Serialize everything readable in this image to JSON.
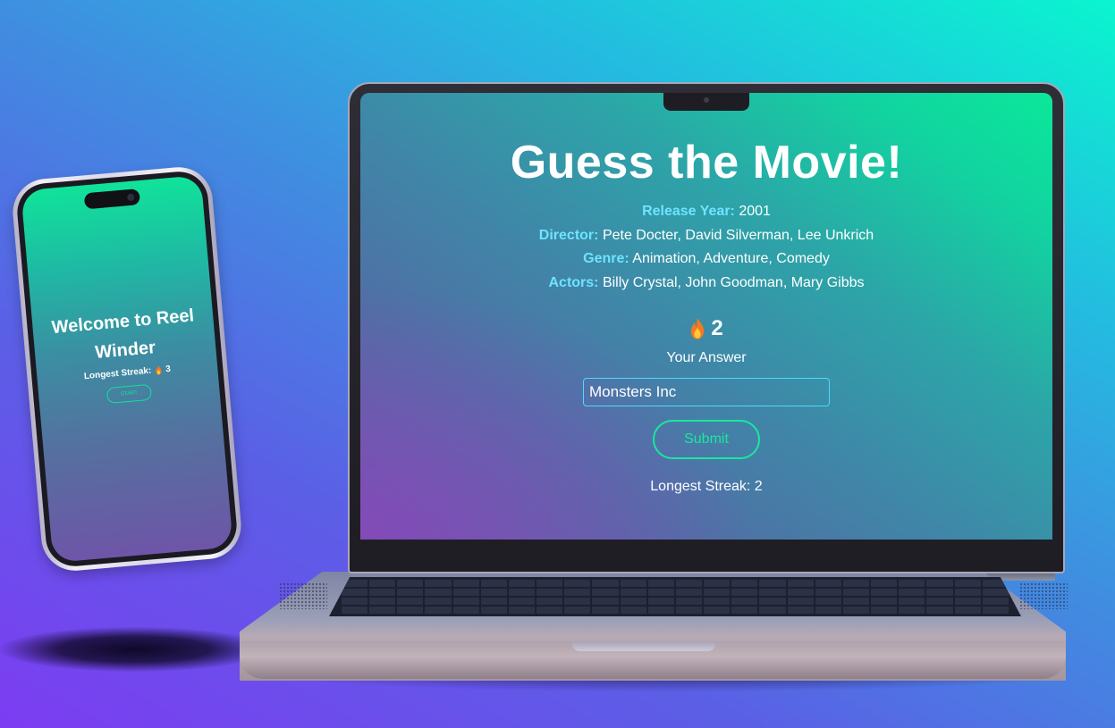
{
  "phone": {
    "title": "Welcome to Reel Winder",
    "streak_label": "Longest Streak:",
    "streak_value": "3",
    "start_label": "START"
  },
  "laptop": {
    "title": "Guess the Movie!",
    "hints": [
      {
        "label": "Release Year:",
        "value": "2001"
      },
      {
        "label": "Director:",
        "value": "Pete Docter, David Silverman, Lee Unkrich"
      },
      {
        "label": "Genre:",
        "value": "Animation, Adventure, Comedy"
      },
      {
        "label": "Actors:",
        "value": "Billy Crystal, John Goodman, Mary Gibbs"
      }
    ],
    "current_streak": "2",
    "answer_label": "Your Answer",
    "answer_value": "Monsters Inc",
    "submit_label": "Submit",
    "longest_streak_text": "Longest Streak: 2"
  },
  "icons": {
    "streak": "flame-icon",
    "webcam": "webcam-icon"
  },
  "colors": {
    "accent_green": "#18e89f",
    "label_cyan": "#6fe3ff",
    "input_border": "#4fd8ff"
  }
}
